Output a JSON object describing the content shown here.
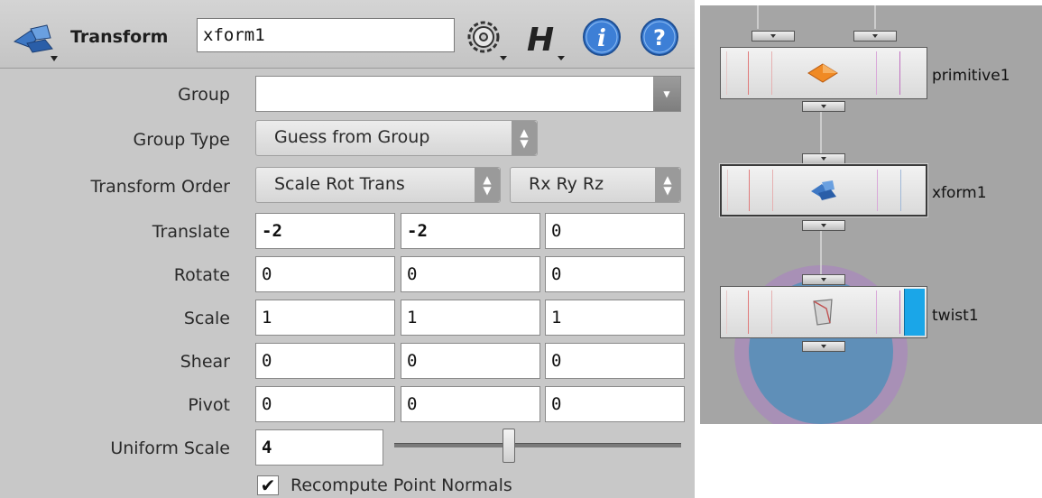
{
  "parameter_editor": {
    "node_type": "Transform",
    "node_name": "xform1",
    "header_icons": [
      "transform-node-icon",
      "gear-icon",
      "houdini-h-icon",
      "info-icon",
      "help-icon"
    ],
    "parameters": {
      "group": {
        "label": "Group",
        "value": ""
      },
      "group_type": {
        "label": "Group Type",
        "value": "Guess from Group"
      },
      "transform_order": {
        "label": "Transform Order",
        "value": "Scale Rot Trans",
        "rotation_order": "Rx Ry Rz"
      },
      "translate": {
        "label": "Translate",
        "values": [
          "-2",
          "-2",
          "0"
        ]
      },
      "rotate": {
        "label": "Rotate",
        "values": [
          "0",
          "0",
          "0"
        ]
      },
      "scale": {
        "label": "Scale",
        "values": [
          "1",
          "1",
          "1"
        ]
      },
      "shear": {
        "label": "Shear",
        "values": [
          "0",
          "0",
          "0"
        ]
      },
      "pivot": {
        "label": "Pivot",
        "values": [
          "0",
          "0",
          "0"
        ]
      },
      "uniform_scale": {
        "label": "Uniform Scale",
        "value": "4",
        "slider_fraction": 0.4
      },
      "recompute_normals": {
        "label": "Recompute Point Normals",
        "checked": true,
        "check_glyph": "✔"
      }
    },
    "colors": {
      "panel_bg": "#c8c8c8",
      "field_bg": "#ffffff"
    }
  },
  "network_editor": {
    "nodes": [
      {
        "name": "primitive1",
        "icon": "primitive-diamond-icon",
        "selected": false,
        "display": false
      },
      {
        "name": "xform1",
        "icon": "transform-node-icon",
        "selected": true,
        "display": false
      },
      {
        "name": "twist1",
        "icon": "twist-node-icon",
        "selected": false,
        "display": true
      }
    ],
    "colors": {
      "background": "#a5a5a5",
      "display_flag": "#1aa6e8",
      "primitive_icon": "#f08a24"
    }
  }
}
